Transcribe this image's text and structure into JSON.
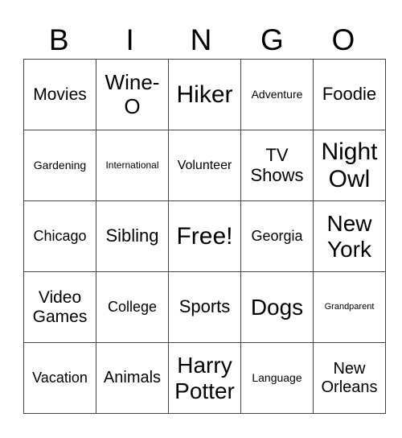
{
  "header": [
    "B",
    "I",
    "N",
    "G",
    "O"
  ],
  "rows": [
    [
      "Movies",
      "Wine-O",
      "Hiker",
      "Adventure",
      "Foodie"
    ],
    [
      "Gardening",
      "International",
      "Volunteer",
      "TV Shows",
      "Night Owl"
    ],
    [
      "Chicago",
      "Sibling",
      "Free!",
      "Georgia",
      "New York"
    ],
    [
      "Video Games",
      "College",
      "Sports",
      "Dogs",
      "Grandparent"
    ],
    [
      "Vacation",
      "Animals",
      "Harry Potter",
      "Language",
      "New Orleans"
    ]
  ]
}
